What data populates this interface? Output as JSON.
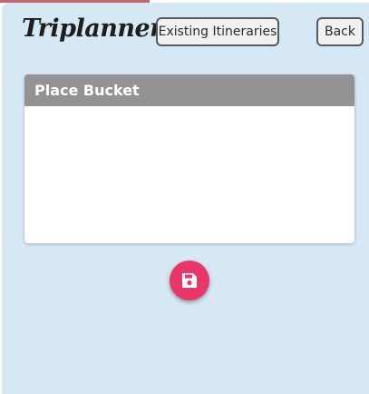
{
  "header": {
    "logo_text": "Triplanner",
    "existing_itineraries_label": "Existing Itineraries",
    "back_label": "Back"
  },
  "place_bucket": {
    "title": "Place Bucket"
  },
  "save_button": {
    "icon": "floppy-disk-icon"
  },
  "colors": {
    "app_background": "#d6e8f4",
    "card_header": "#939393",
    "save_button": "#e8386a",
    "top_accent": "#c5666c"
  }
}
